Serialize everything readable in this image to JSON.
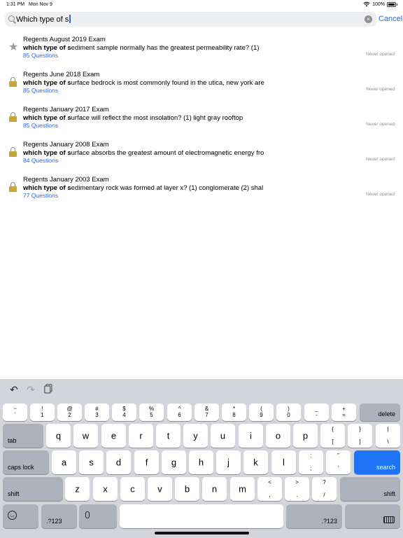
{
  "status": {
    "time": "1:31 PM",
    "date": "Mon Nov 9",
    "battery": "100%"
  },
  "search": {
    "value": "Which type of s",
    "cancel_label": "Cancel"
  },
  "results": [
    {
      "icon": "star-icon",
      "title": "Regents August 2019 Exam",
      "match": "which type of s",
      "snippet": "ediment sample normally has the greatest permeability rate? (1)",
      "count": "85 Questions",
      "status": "Never opened"
    },
    {
      "icon": "lock-icon",
      "title": "Regents June 2018 Exam",
      "match": "which type of s",
      "snippet": "urface bedrock is most commonly found in the utica, new york are",
      "count": "85 Questions",
      "status": "Never opened"
    },
    {
      "icon": "lock-icon",
      "title": "Regents January 2017 Exam",
      "match": "which type of s",
      "snippet": "urface will reflect the most insolation? (1) light gray rooftop",
      "count": "85 Questions",
      "status": "Never opened"
    },
    {
      "icon": "lock-icon",
      "title": "Regents January 2008 Exam",
      "match": "which type of s",
      "snippet": "urface absorbs the greatest amount of electromagnetic energy fro",
      "count": "84 Questions",
      "status": "Never opened"
    },
    {
      "icon": "lock-icon",
      "title": "Regents January 2003 Exam",
      "match": "which type of s",
      "snippet": "edimentary rock was formed at layer x? (1) conglomerate (2) shal",
      "count": "77 Questions",
      "status": "Never opened"
    }
  ],
  "keyboard": {
    "number_row": [
      {
        "top": "~",
        "bot": "`"
      },
      {
        "top": "!",
        "bot": "1"
      },
      {
        "top": "@",
        "bot": "2"
      },
      {
        "top": "#",
        "bot": "3"
      },
      {
        "top": "$",
        "bot": "4"
      },
      {
        "top": "%",
        "bot": "5"
      },
      {
        "top": "^",
        "bot": "6"
      },
      {
        "top": "&",
        "bot": "7"
      },
      {
        "top": "*",
        "bot": "8"
      },
      {
        "top": "(",
        "bot": "9"
      },
      {
        "top": ")",
        "bot": "0"
      },
      {
        "top": "_",
        "bot": "-"
      },
      {
        "top": "+",
        "bot": "="
      }
    ],
    "delete_label": "delete",
    "tab_label": "tab",
    "row_q": [
      "q",
      "w",
      "e",
      "r",
      "t",
      "y",
      "u",
      "i",
      "o",
      "p"
    ],
    "brace_keys": [
      {
        "top": "{",
        "bot": "["
      },
      {
        "top": "}",
        "bot": "]"
      },
      {
        "top": "|",
        "bot": "\\"
      }
    ],
    "caps_label": "caps lock",
    "row_a": [
      "a",
      "s",
      "d",
      "f",
      "g",
      "h",
      "j",
      "k",
      "l"
    ],
    "punct_a": [
      {
        "top": ":",
        "bot": ";"
      },
      {
        "top": "”",
        "bot": "’"
      }
    ],
    "search_label": "search",
    "shift_label": "shift",
    "row_z": [
      "z",
      "x",
      "c",
      "v",
      "b",
      "n",
      "m"
    ],
    "punct_z": [
      {
        "top": "<",
        "bot": ","
      },
      {
        "top": ">",
        "bot": "."
      },
      {
        "top": "?",
        "bot": "/"
      }
    ],
    "numbers_label": ".?123",
    "icons": {
      "undo": "undo-icon",
      "redo": "redo-icon",
      "paste": "paste-icon",
      "emoji": "emoji-icon",
      "mic": "microphone-icon",
      "hide": "keyboard-hide-icon"
    }
  }
}
